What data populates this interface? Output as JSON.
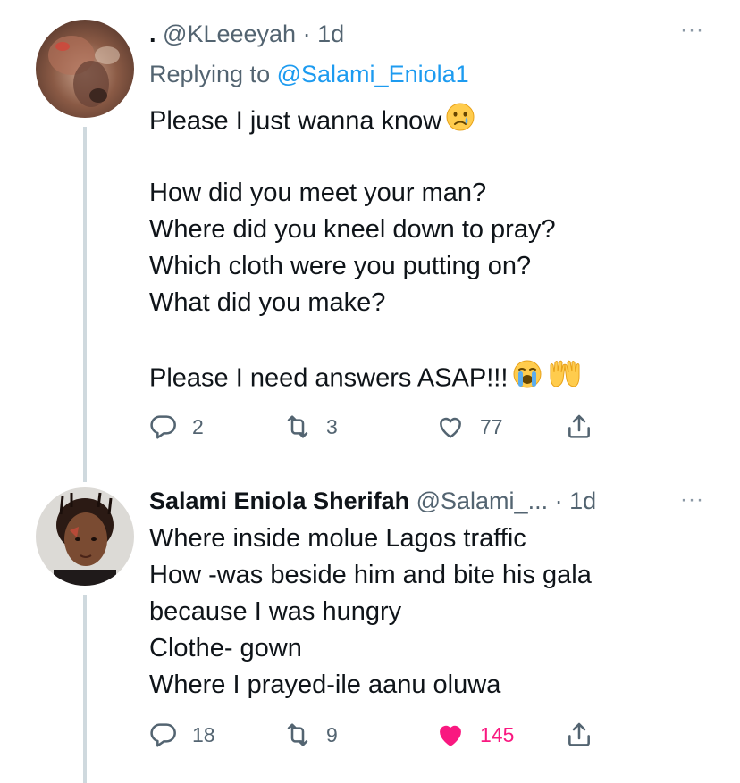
{
  "tweets": [
    {
      "display_name": ".",
      "handle": "@KLeeeyah",
      "dot": "·",
      "time": "1d",
      "replying_prefix": "Replying to",
      "replying_to": "@Salami_Eniola1",
      "more": "···",
      "lines": [
        "Please I just wanna know",
        "",
        "How did you meet your man?",
        "Where did you kneel down to pray?",
        "Which cloth were you putting on?",
        "What did you make?",
        "",
        "Please I need answers ASAP!!!"
      ],
      "emojis": [
        "crying-face-emoji",
        "loudly-crying-face-emoji",
        "raising-hands-emoji"
      ],
      "stats": {
        "replies": "2",
        "retweets": "3",
        "likes": "77",
        "liked": false
      }
    },
    {
      "display_name": "Salami Eniola Sherifah",
      "handle": "@Salami_...",
      "dot": "·",
      "time": "1d",
      "more": "···",
      "lines": [
        "Where inside molue Lagos traffic",
        "How -was beside him and bite his gala",
        "because I was hungry",
        "Clothe- gown",
        "Where I prayed-ile aanu oluwa"
      ],
      "stats": {
        "replies": "18",
        "retweets": "9",
        "likes": "145",
        "liked": true
      }
    }
  ],
  "colors": {
    "text": "#0f1419",
    "secondary": "#536471",
    "link": "#1d9bf0",
    "like": "#f91880",
    "thread_line": "#cfd9de"
  }
}
